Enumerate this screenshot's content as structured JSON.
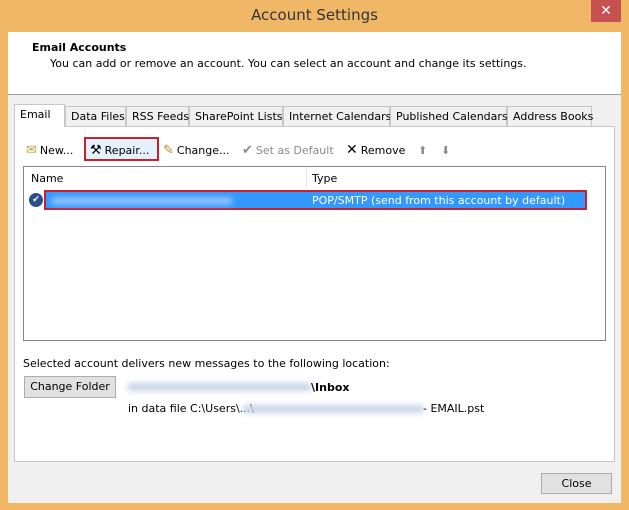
{
  "window": {
    "title": "Account Settings",
    "close_icon": "close-icon"
  },
  "header": {
    "title": "Email Accounts",
    "description": "You can add or remove an account. You can select an account and change its settings."
  },
  "tabs": [
    {
      "label": "Email",
      "active": true
    },
    {
      "label": "Data Files"
    },
    {
      "label": "RSS Feeds"
    },
    {
      "label": "SharePoint Lists"
    },
    {
      "label": "Internet Calendars"
    },
    {
      "label": "Published Calendars"
    },
    {
      "label": "Address Books"
    }
  ],
  "toolbar": {
    "new": "New...",
    "repair": "Repair...",
    "change": "Change...",
    "set_default": "Set as Default",
    "remove": "Remove"
  },
  "list": {
    "columns": [
      "Name",
      "Type"
    ],
    "rows": [
      {
        "name": "",
        "type": "POP/SMTP (send from this account by default)",
        "selected": true,
        "default": true
      }
    ]
  },
  "delivery": {
    "label": "Selected account delivers new messages to the following location:",
    "change_folder": "Change Folder",
    "folder": "\\Inbox",
    "data_file_prefix": "in data file C:\\Users\\...\\",
    "data_file_suffix": " - EMAIL.pst"
  },
  "footer": {
    "close": "Close"
  },
  "colors": {
    "border": "#f0b866",
    "selection": "#3399ff",
    "highlight": "#c8202c"
  }
}
